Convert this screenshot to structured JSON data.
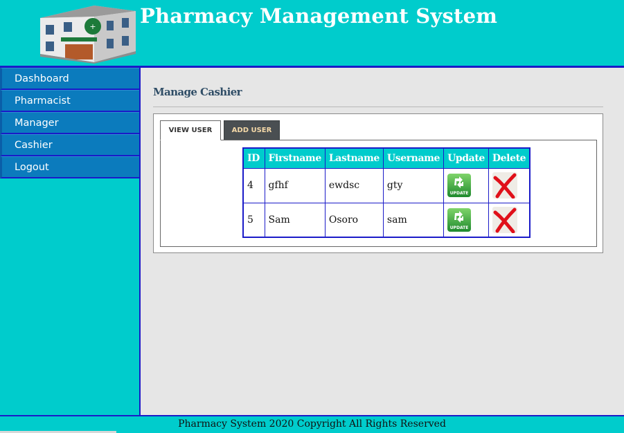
{
  "header": {
    "title": "Pharmacy Management System",
    "logo_icon": "pharmacy-building-icon"
  },
  "sidebar": {
    "items": [
      {
        "label": "Dashboard"
      },
      {
        "label": "Pharmacist"
      },
      {
        "label": "Manager"
      },
      {
        "label": "Cashier"
      },
      {
        "label": "Logout"
      }
    ]
  },
  "main": {
    "title": "Manage Cashier",
    "tabs": [
      {
        "label": "VIEW USER"
      },
      {
        "label": "ADD USER"
      }
    ],
    "table": {
      "headers": [
        "ID",
        "Firstname",
        "Lastname",
        "Username",
        "Update",
        "Delete"
      ],
      "rows": [
        {
          "id": "4",
          "firstname": "gfhf",
          "lastname": "ewdsc",
          "username": "gty"
        },
        {
          "id": "5",
          "firstname": "Sam",
          "lastname": "Osoro",
          "username": "sam"
        }
      ],
      "update_icon_text": "UPDATE"
    }
  },
  "footer": {
    "text": "Pharmacy System 2020 Copyright All Rights Reserved"
  },
  "colors": {
    "accent": "#00cccc",
    "nav": "#0b7bbd",
    "border": "#1a1ac8"
  }
}
